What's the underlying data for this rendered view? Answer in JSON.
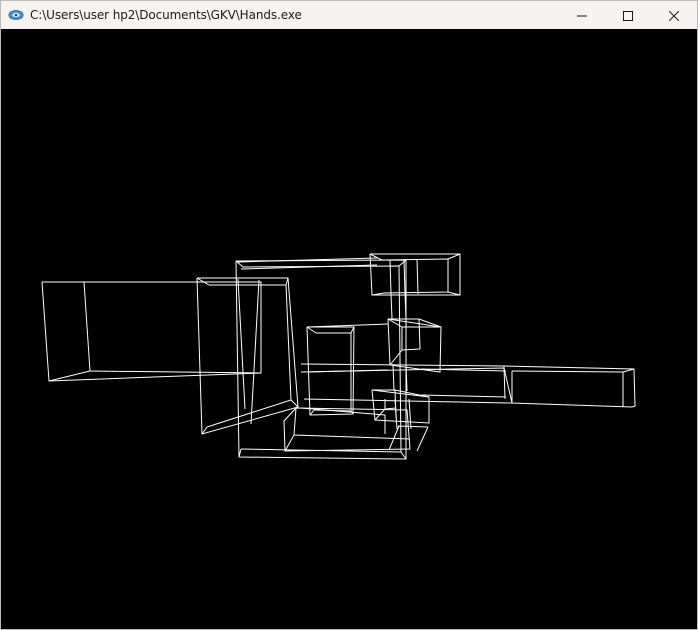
{
  "window": {
    "title": "C:\\Users\\user hp2\\Documents\\GKV\\Hands.exe"
  },
  "caption": {
    "minimize_icon": "minimize-icon",
    "maximize_icon": "maximize-icon",
    "close_icon": "close-icon"
  },
  "scene": {
    "render_mode": "wireframe",
    "background_color": "#000000",
    "stroke_color": "#ffffff"
  }
}
